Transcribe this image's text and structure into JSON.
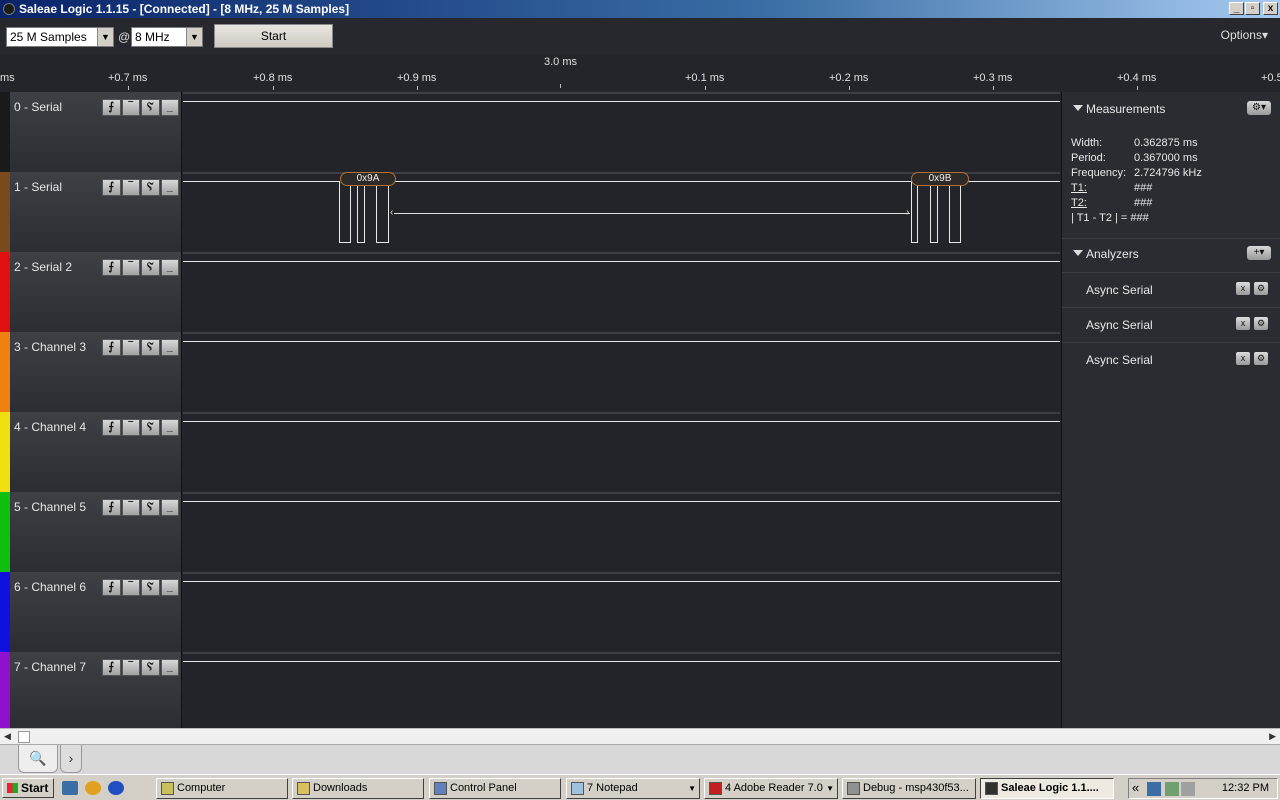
{
  "window": {
    "title": "Saleae Logic 1.1.15 - [Connected] - [8 MHz, 25 M Samples]",
    "minimize": "_",
    "restore": "▫",
    "close": "x"
  },
  "toolbar": {
    "samples_value": "25 M Samples",
    "at_symbol": "@",
    "rate_value": "8 MHz",
    "start_label": "Start",
    "options_label": "Options▾"
  },
  "ruler": {
    "center_label": "3.0 ms",
    "ticks": [
      {
        "label": "ms"
      },
      {
        "label": "+0.7 ms"
      },
      {
        "label": "+0.8 ms"
      },
      {
        "label": "+0.9 ms"
      },
      {
        "label": "+0.1 ms"
      },
      {
        "label": "+0.2 ms"
      },
      {
        "label": "+0.3 ms"
      },
      {
        "label": "+0.4 ms"
      },
      {
        "label": "+0.5"
      }
    ]
  },
  "channels": [
    {
      "name": "0 - Serial",
      "color": "#1a1a1a"
    },
    {
      "name": "1 - Serial",
      "color": "#7a4a1a"
    },
    {
      "name": "2 - Serial 2",
      "color": "#e01010"
    },
    {
      "name": "3 - Channel 3",
      "color": "#f08010"
    },
    {
      "name": "4 - Channel 4",
      "color": "#f0e010"
    },
    {
      "name": "5 - Channel 5",
      "color": "#10c010"
    },
    {
      "name": "6 - Channel 6",
      "color": "#1010e0"
    },
    {
      "name": "7 - Channel 7",
      "color": "#9010d0"
    }
  ],
  "trigger_buttons": [
    "⨍",
    "‾",
    "Ⲋ",
    "_"
  ],
  "decoded": {
    "first": "0x9A",
    "second": "0x9B"
  },
  "measurements": {
    "title": "Measurements",
    "settings_icon": "⚙▾",
    "rows": [
      {
        "key": "Width:",
        "value": "0.362875 ms"
      },
      {
        "key": "Period:",
        "value": "0.367000 ms"
      },
      {
        "key": "Frequency:",
        "value": "2.724796 kHz"
      },
      {
        "key": "T1:",
        "value": "###"
      },
      {
        "key": "T2:",
        "value": "###"
      },
      {
        "key": "| T1 - T2 | =",
        "value": "###"
      }
    ]
  },
  "analyzers": {
    "title": "Analyzers",
    "add_icon": "+▾",
    "items": [
      {
        "name": "Async Serial"
      },
      {
        "name": "Async Serial"
      },
      {
        "name": "Async Serial"
      }
    ],
    "remove_icon": "x",
    "settings_icon": "⚙"
  },
  "bottom_tabs": {
    "search_icon": "🔍",
    "next_icon": "›"
  },
  "taskbar": {
    "start_label": "Start",
    "tasks": [
      {
        "label": "Computer"
      },
      {
        "label": "Downloads"
      },
      {
        "label": "Control Panel"
      },
      {
        "label": "7 Notepad"
      },
      {
        "label": "4 Adobe Reader 7.0"
      },
      {
        "label": "Debug - msp430f53..."
      },
      {
        "label": "Saleae Logic 1.1...."
      }
    ],
    "clock": "12:32 PM",
    "chevron": "«"
  }
}
